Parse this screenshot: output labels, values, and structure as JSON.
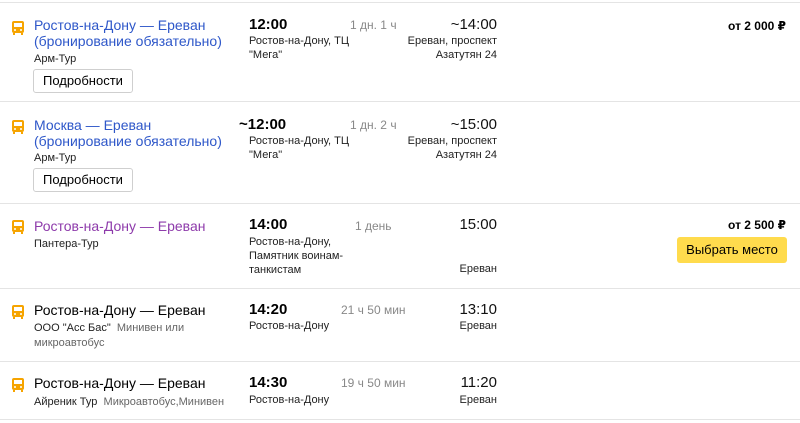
{
  "colors": {
    "bus_icon": "#f6a400",
    "link": "#2e57c9",
    "visited_link": "#8e3bab",
    "buy_button": "#ffdb4d"
  },
  "icons": {
    "bus": "bus-icon"
  },
  "rows": [
    {
      "route": "Ростов-на-Дону — Ереван (бронирование обязательно)",
      "carrier": "Арм-Тур",
      "details_label": "Подробности",
      "dep_time": "12:00",
      "dep_place": "Ростов-на-Дону, ТЦ \"Мега\"",
      "duration": "1 дн. 1 ч",
      "arr_time": "~14:00",
      "arr_place": "Ереван, проспект Азатутян 24",
      "price": "от 2 000 ₽"
    },
    {
      "route": "Москва — Ереван (бронирование обязательно)",
      "carrier": "Арм-Тур",
      "details_label": "Подробности",
      "dep_time": "~12:00",
      "dep_place": "Ростов-на-Дону, ТЦ \"Мега\"",
      "duration": "1 дн. 2 ч",
      "arr_time": "~15:00",
      "arr_place": "Ереван, проспект Азатутян 24"
    },
    {
      "route": "Ростов-на-Дону — Ереван",
      "carrier": "Пантера-Тур",
      "dep_time": "14:00",
      "dep_place": "Ростов-на-Дону, Памятник воинам-танкистам",
      "duration": "1 день",
      "arr_time": "15:00",
      "arr_place": "Ереван",
      "price": "от 2 500 ₽",
      "buy_label": "Выбрать место"
    },
    {
      "route": "Ростов-на-Дону — Ереван",
      "carrier": "ООО \"Асс Бас\"",
      "vehicle": "Минивен или микроавтобус",
      "dep_time": "14:20",
      "dep_place": "Ростов-на-Дону",
      "duration": "21 ч 50 мин",
      "arr_time": "13:10",
      "arr_place": "Ереван"
    },
    {
      "route": "Ростов-на-Дону — Ереван",
      "carrier": "Айреник Тур",
      "vehicle": "Микроавтобус,Минивен",
      "dep_time": "14:30",
      "dep_place": "Ростов-на-Дону",
      "duration": "19 ч 50 мин",
      "arr_time": "11:20",
      "arr_place": "Ереван"
    }
  ]
}
